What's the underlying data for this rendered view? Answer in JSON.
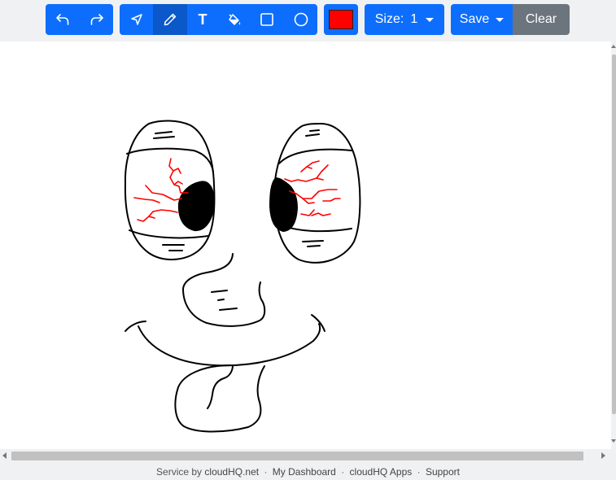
{
  "toolbar": {
    "history": [
      {
        "name": "undo-icon"
      },
      {
        "name": "redo-icon"
      }
    ],
    "tools": [
      {
        "name": "select-arrow-icon",
        "active": false
      },
      {
        "name": "pencil-icon",
        "active": true
      },
      {
        "name": "text-tool-icon",
        "label": "T",
        "active": false
      },
      {
        "name": "paint-bucket-icon",
        "active": false
      },
      {
        "name": "rectangle-icon",
        "active": false
      },
      {
        "name": "circle-icon",
        "active": false
      }
    ],
    "color": "#ff0000",
    "size_label": "Size:",
    "size_value": "1",
    "save_label": "Save",
    "clear_label": "Clear"
  },
  "footer": {
    "service_by": "Service by",
    "brand": "cloudHQ.net",
    "links": [
      "My Dashboard",
      "cloudHQ Apps",
      "Support"
    ]
  },
  "canvas": {
    "stroke_colors": {
      "outline": "#000000",
      "veins": "#ff0000"
    }
  }
}
